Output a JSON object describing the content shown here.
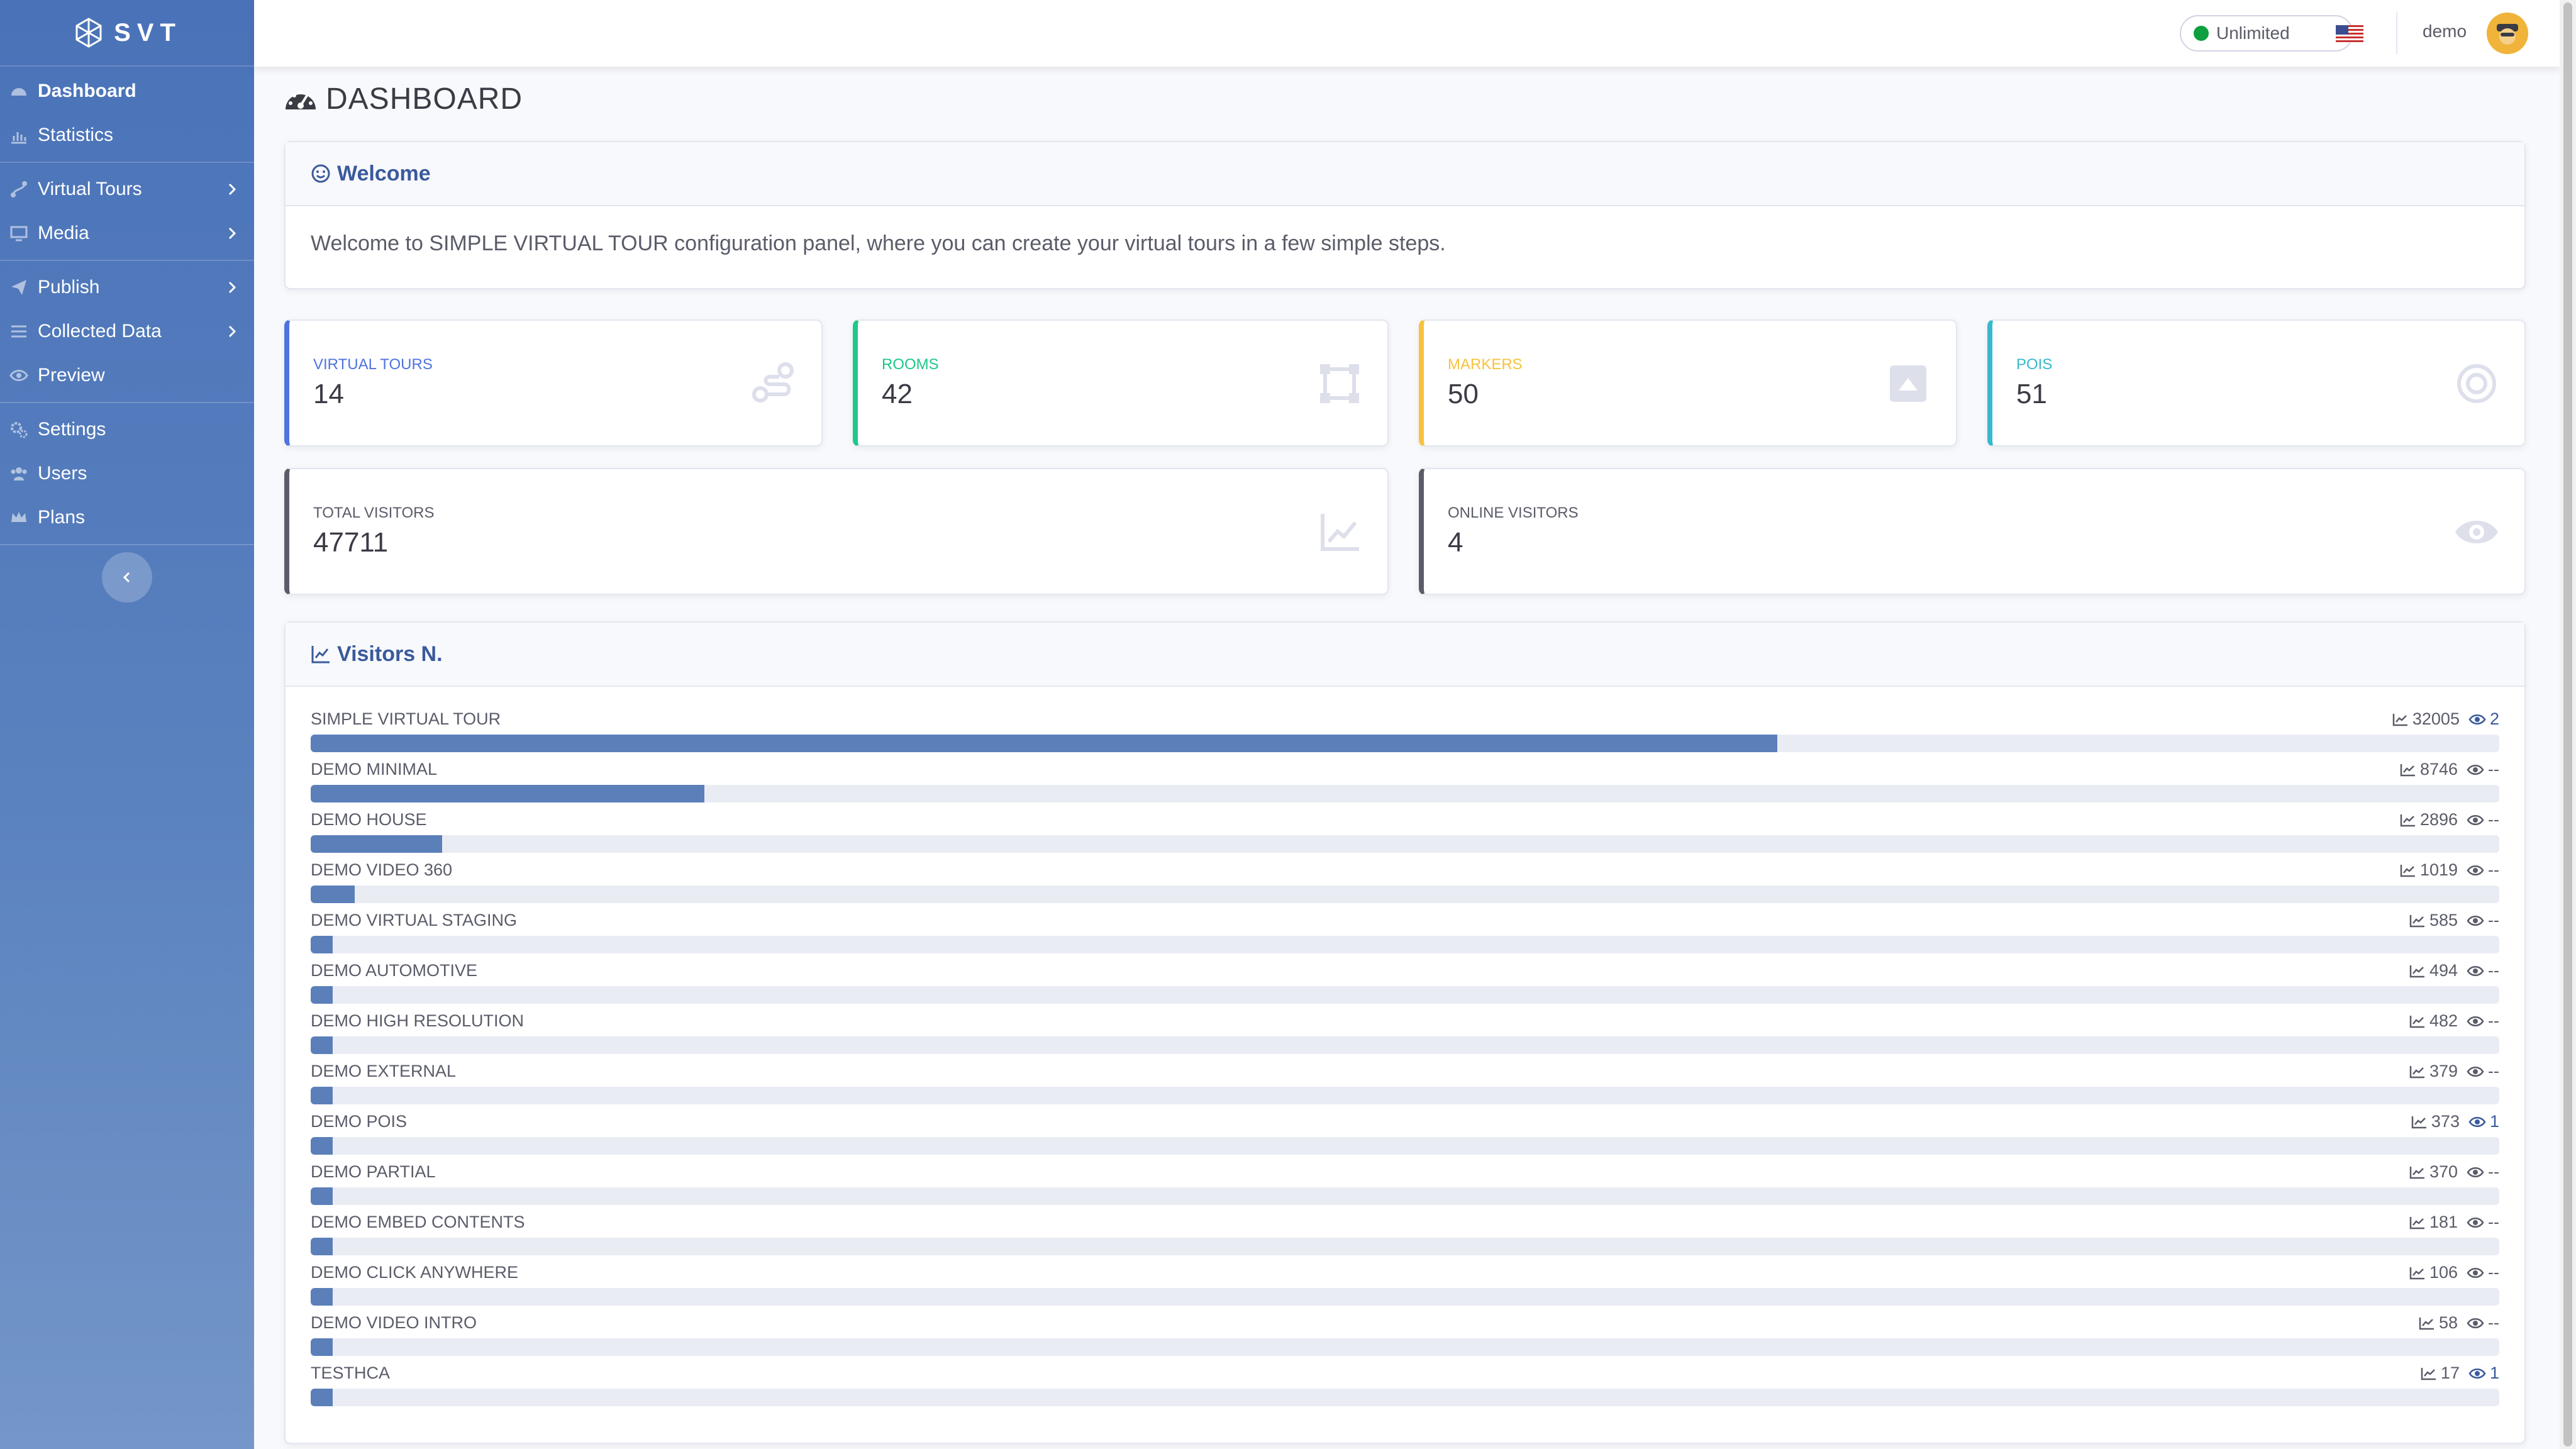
{
  "brand": {
    "name": "SVT"
  },
  "sidebar": {
    "items": [
      {
        "label": "Dashboard"
      },
      {
        "label": "Statistics"
      },
      {
        "label": "Virtual Tours"
      },
      {
        "label": "Media"
      },
      {
        "label": "Publish"
      },
      {
        "label": "Collected Data"
      },
      {
        "label": "Preview"
      },
      {
        "label": "Settings"
      },
      {
        "label": "Users"
      },
      {
        "label": "Plans"
      }
    ]
  },
  "topbar": {
    "plan": "Unlimited",
    "username": "demo"
  },
  "page": {
    "title": "DASHBOARD"
  },
  "welcome": {
    "title": "Welcome",
    "text": "Welcome to SIMPLE VIRTUAL TOUR configuration panel, where you can create your virtual tours in a few simple steps."
  },
  "stats": [
    {
      "label": "VIRTUAL TOURS",
      "value": "14",
      "color": "#4e73df"
    },
    {
      "label": "ROOMS",
      "value": "42",
      "color": "#1cc88a"
    },
    {
      "label": "MARKERS",
      "value": "50",
      "color": "#f6c23e"
    },
    {
      "label": "POIS",
      "value": "51",
      "color": "#36b9cc"
    },
    {
      "label": "TOTAL VISITORS",
      "value": "47711",
      "color": "#5a5c69"
    },
    {
      "label": "ONLINE VISITORS",
      "value": "4",
      "color": "#5a5c69"
    }
  ],
  "visitors": {
    "title": "Visitors N.",
    "rows": [
      {
        "name": "SIMPLE VIRTUAL TOUR",
        "total": "32005",
        "online": "2",
        "fraction": 0.67
      },
      {
        "name": "DEMO MINIMAL",
        "total": "8746",
        "online": "--",
        "fraction": 0.18
      },
      {
        "name": "DEMO HOUSE",
        "total": "2896",
        "online": "--",
        "fraction": 0.06
      },
      {
        "name": "DEMO VIDEO 360",
        "total": "1019",
        "online": "--",
        "fraction": 0.02
      },
      {
        "name": "DEMO VIRTUAL STAGING",
        "total": "585",
        "online": "--",
        "fraction": 0.01
      },
      {
        "name": "DEMO AUTOMOTIVE",
        "total": "494",
        "online": "--",
        "fraction": 0.01
      },
      {
        "name": "DEMO HIGH RESOLUTION",
        "total": "482",
        "online": "--",
        "fraction": 0.01
      },
      {
        "name": "DEMO EXTERNAL",
        "total": "379",
        "online": "--",
        "fraction": 0.01
      },
      {
        "name": "DEMO POIS",
        "total": "373",
        "online": "1",
        "fraction": 0.01
      },
      {
        "name": "DEMO PARTIAL",
        "total": "370",
        "online": "--",
        "fraction": 0.01
      },
      {
        "name": "DEMO EMBED CONTENTS",
        "total": "181",
        "online": "--",
        "fraction": 0
      },
      {
        "name": "DEMO CLICK ANYWHERE",
        "total": "106",
        "online": "--",
        "fraction": 0
      },
      {
        "name": "DEMO VIDEO INTRO",
        "total": "58",
        "online": "--",
        "fraction": 0
      },
      {
        "name": "TESTHCA",
        "total": "17",
        "online": "1",
        "fraction": 0
      }
    ]
  }
}
